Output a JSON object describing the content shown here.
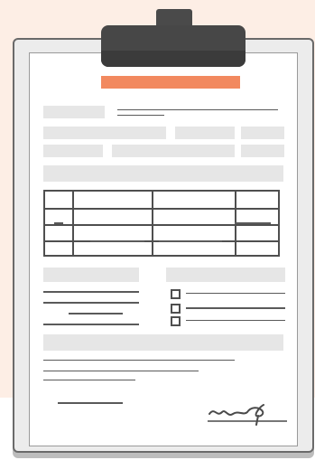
{
  "colors": {
    "background_panel": "#fdeee5",
    "accent_title_band": "#f2895f",
    "clip": "#474747",
    "board": "#ececec",
    "paper": "#ffffff",
    "lines": "#5a5a5a",
    "placeholder_bars": "#e6e6e6"
  },
  "illustration": {
    "type": "clipboard-form",
    "checkbox_count": 3,
    "table_rows": 3,
    "table_cols": 4,
    "has_signature": true
  },
  "icons": [
    "clipboard-clip-icon",
    "checkbox-icon",
    "signature-icon"
  ]
}
